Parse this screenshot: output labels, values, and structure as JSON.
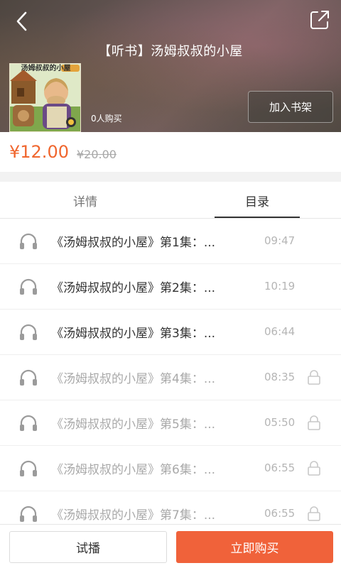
{
  "header": {
    "title": "【听书】汤姆叔叔的小屋",
    "cover_caption": "汤姆叔叔的小屋",
    "buyers": "0人购买",
    "add_shelf_label": "加入书架"
  },
  "price": {
    "current": "¥12.00",
    "original": "¥20.00"
  },
  "tabs": [
    {
      "label": "详情",
      "active": false
    },
    {
      "label": "目录",
      "active": true
    }
  ],
  "episodes": [
    {
      "title": "《汤姆叔叔的小屋》第1集：...",
      "duration": "09:47",
      "locked": false
    },
    {
      "title": "《汤姆叔叔的小屋》第2集：...",
      "duration": "10:19",
      "locked": false
    },
    {
      "title": "《汤姆叔叔的小屋》第3集：...",
      "duration": "06:44",
      "locked": false
    },
    {
      "title": "《汤姆叔叔的小屋》第4集：...",
      "duration": "08:35",
      "locked": true
    },
    {
      "title": "《汤姆叔叔的小屋》第5集：...",
      "duration": "05:50",
      "locked": true
    },
    {
      "title": "《汤姆叔叔的小屋》第6集：...",
      "duration": "06:55",
      "locked": true
    },
    {
      "title": "《汤姆叔叔的小屋》第7集：...",
      "duration": "06:55",
      "locked": true
    }
  ],
  "footer": {
    "trial_label": "试播",
    "buy_label": "立即购买"
  },
  "colors": {
    "accent": "#f0623a",
    "price": "#f0662e"
  },
  "icons": {
    "back": "back-arrow-icon",
    "share": "share-icon",
    "episode": "headphones-icon",
    "locked": "lock-icon"
  }
}
